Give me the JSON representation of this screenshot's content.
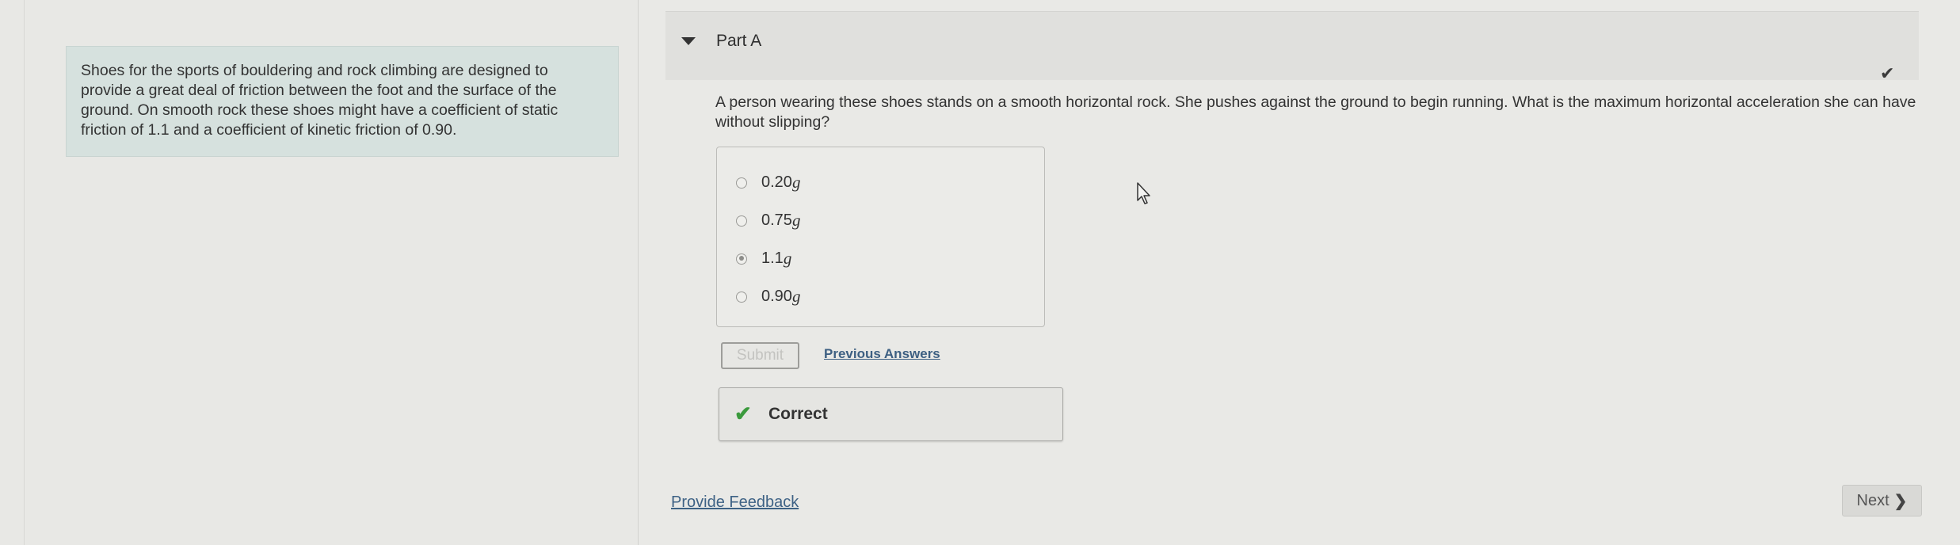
{
  "intro": {
    "text": "Shoes for the sports of bouldering and rock climbing are designed to provide a great deal of friction between the foot and the surface of the ground. On smooth rock these shoes might have a coefficient of static friction of 1.1 and a coefficient of kinetic friction of 0.90."
  },
  "part": {
    "title": "Part A",
    "status_icon": "checkmark-icon"
  },
  "question": {
    "text": "A person wearing these shoes stands on a smooth horizontal rock. She pushes against the ground to begin running. What is the maximum horizontal acceleration she can have without slipping?"
  },
  "choices": [
    {
      "value": "0.20",
      "unit": "g",
      "selected": false
    },
    {
      "value": "0.75",
      "unit": "g",
      "selected": false
    },
    {
      "value": "1.1",
      "unit": "g",
      "selected": true
    },
    {
      "value": "0.90",
      "unit": "g",
      "selected": false
    }
  ],
  "actions": {
    "submit_label": "Submit",
    "previous_answers_label": "Previous Answers"
  },
  "result": {
    "label": "Correct",
    "icon": "checkmark-icon",
    "color": "#3b9a3d"
  },
  "footer": {
    "feedback_label": "Provide Feedback",
    "next_label": "Next"
  }
}
